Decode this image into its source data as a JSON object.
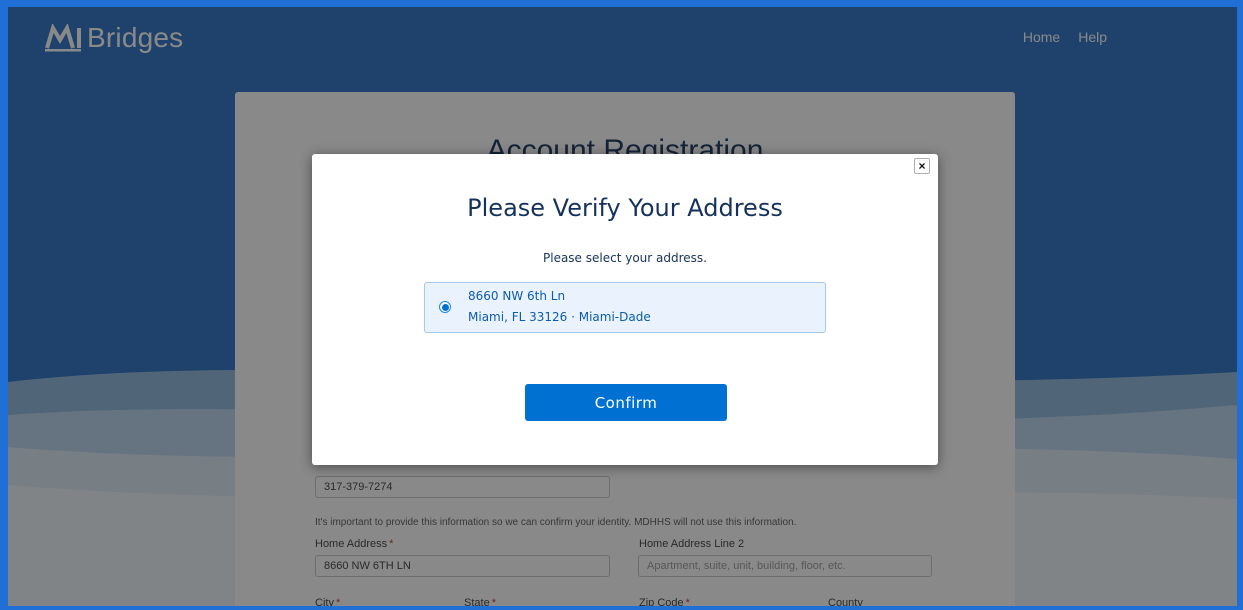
{
  "header": {
    "logo_text": "Bridges",
    "nav": [
      {
        "label": "Home"
      },
      {
        "label": "Help"
      }
    ]
  },
  "registration": {
    "title": "Account Registration",
    "phone_value": "317-379-7274",
    "identity_note": "It's important to provide this information so we can confirm your identity. MDHHS will not use this information.",
    "home_address_label": "Home Address",
    "home_address_value": "8660 NW 6TH LN",
    "address_line2_label": "Home Address Line 2",
    "address_line2_placeholder": "Apartment, suite, unit, building, floor, etc.",
    "city_label": "City",
    "state_label": "State",
    "zip_label": "Zip Code",
    "county_label": "County"
  },
  "modal": {
    "close_symbol": "×",
    "title": "Please Verify Your Address",
    "subtitle": "Please select your address.",
    "option": {
      "line1": "8660 NW 6th Ln",
      "line2": "Miami, FL 33126 · Miami-Dade",
      "selected": true
    },
    "confirm_label": "Confirm"
  },
  "colors": {
    "background_blue": "#2870c4",
    "wave_light": "#cfe0ef",
    "primary_button": "#0070d2",
    "modal_title": "#16325c",
    "option_bg": "#eaf3fd",
    "required_marker": "#c23934"
  }
}
